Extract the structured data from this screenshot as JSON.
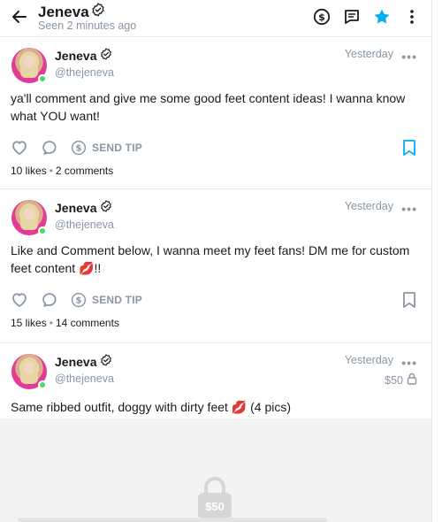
{
  "header": {
    "name": "Jeneva",
    "status": "Seen  2 minutes ago",
    "icons": [
      "back-arrow-icon",
      "verified-icon",
      "dollar-icon",
      "chat-note-icon",
      "star-icon",
      "more-vertical-icon"
    ],
    "accent": "#00aff0"
  },
  "posts": [
    {
      "name": "Jeneva",
      "handle": "@thejeneva",
      "time": "Yesterday",
      "text": "ya'll comment and give me some good feet content ideas! I wanna know what YOU want!",
      "tip_label": "SEND TIP",
      "likes": "10 likes",
      "comments": "2 comments"
    },
    {
      "name": "Jeneva",
      "handle": "@thejeneva",
      "time": "Yesterday",
      "text": "Like and Comment below, I wanna meet my feet fans! DM me for custom feet content 💋!!",
      "tip_label": "SEND TIP",
      "likes": "15 likes",
      "comments": "14 comments"
    },
    {
      "name": "Jeneva",
      "handle": "@thejeneva",
      "time": "Yesterday",
      "price": "$50",
      "text": "Same ribbed outfit, doggy with dirty feet 💋 (4 pics)"
    }
  ],
  "locked": {
    "price": "$50"
  },
  "colors": {
    "muted": "#8a96a3",
    "online": "#4cd964",
    "avatar_bg": "#e33a96",
    "bookmark": "#00aff0"
  }
}
